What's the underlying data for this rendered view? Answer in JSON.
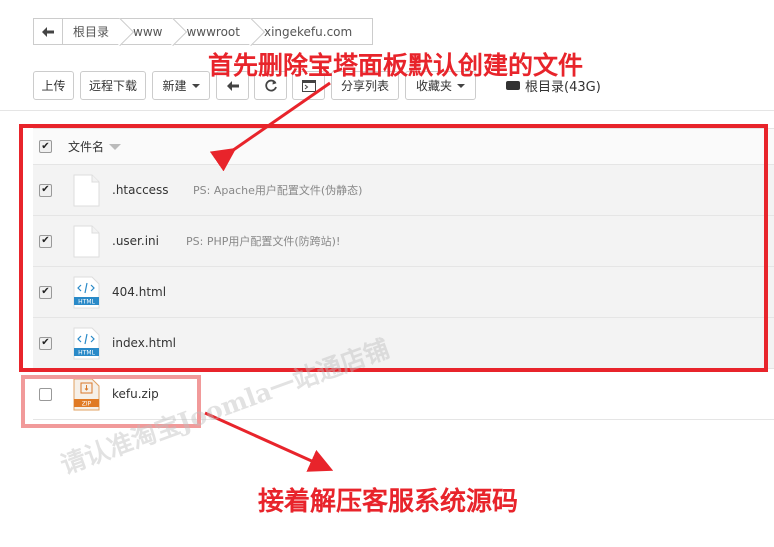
{
  "breadcrumb": {
    "items": [
      "根目录",
      "www",
      "wwwroot",
      "xingekefu.com"
    ]
  },
  "toolbar": {
    "upload": "上传",
    "remote_download": "远程下载",
    "new": "新建",
    "share_list": "分享列表",
    "favorites": "收藏夹",
    "disk": "根目录(43G)"
  },
  "table": {
    "header": "文件名",
    "files": [
      {
        "name": ".htaccess",
        "note": "PS: Apache用户配置文件(伪静态)",
        "type": "blank",
        "checked": true
      },
      {
        "name": ".user.ini",
        "note": "PS: PHP用户配置文件(防跨站)!",
        "type": "blank",
        "checked": true
      },
      {
        "name": "404.html",
        "note": "",
        "type": "html",
        "checked": true
      },
      {
        "name": "index.html",
        "note": "",
        "type": "html",
        "checked": true
      },
      {
        "name": "kefu.zip",
        "note": "",
        "type": "zip",
        "checked": false
      }
    ],
    "html_badge": "HTML",
    "zip_badge": "ZIP"
  },
  "annotations": {
    "top": "首先删除宝塔面板默认创建的文件",
    "bottom": "接着解压客服系统源码",
    "color": "#e8242b"
  },
  "watermark": "请认准淘宝Joomla一站通店铺"
}
